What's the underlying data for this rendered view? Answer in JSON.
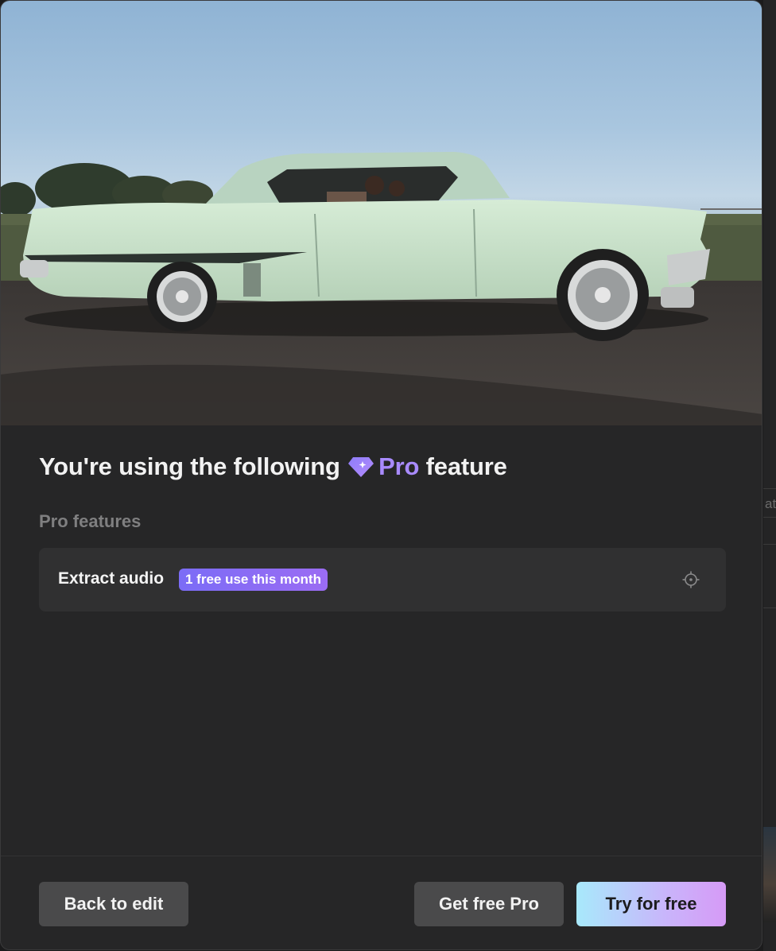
{
  "dialog": {
    "title_prefix": "You're using the following",
    "title_pro": "Pro",
    "title_suffix": "feature",
    "section_label": "Pro features",
    "features": [
      {
        "name": "Extract audio",
        "badge": "1 free use this month",
        "icon": "locate-icon"
      }
    ],
    "buttons": {
      "back": "Back to edit",
      "get_free_pro": "Get free Pro",
      "try_free": "Try for free"
    }
  },
  "background": {
    "edge_text": "ati"
  },
  "colors": {
    "pro_accent": "#a98bff",
    "badge_gradient": [
      "#7b6cf6",
      "#9b6cf3"
    ],
    "try_gradient": [
      "#a8e9fb",
      "#c9b5fb",
      "#d69af6"
    ],
    "modal_bg": "#262627"
  }
}
